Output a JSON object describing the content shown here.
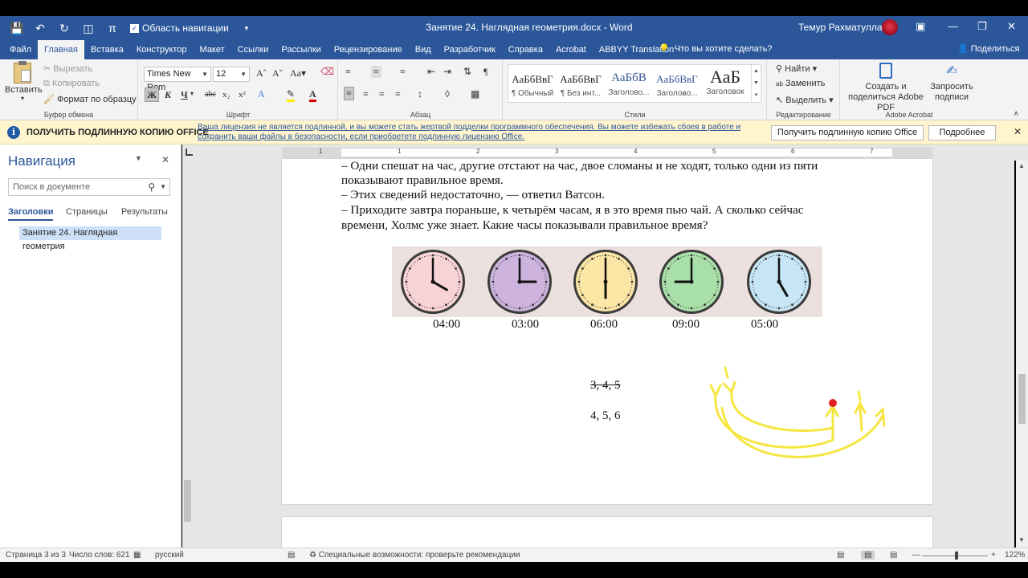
{
  "window": {
    "doc_title": "Занятие 24. Наглядная геометрия.docx  -  Word",
    "user_name": "Темур Рахматуллаев",
    "qat_nav_label": "Область навигации"
  },
  "tabs": [
    "Файл",
    "Главная",
    "Вставка",
    "Конструктор",
    "Макет",
    "Ссылки",
    "Рассылки",
    "Рецензирование",
    "Вид",
    "Разработчик",
    "Справка",
    "Acrobat",
    "ABBYY Translation"
  ],
  "tell_me": "Что вы хотите сделать?",
  "share": "Поделиться",
  "ribbon": {
    "clipboard": {
      "paste": "Вставить",
      "cut": "Вырезать",
      "copy": "Копировать",
      "format_painter": "Формат по образцу",
      "label": "Буфер обмена"
    },
    "font": {
      "name": "Times New Rom",
      "size": "12",
      "label": "Шрифт"
    },
    "paragraph": {
      "label": "Абзац"
    },
    "styles": {
      "label": "Стили",
      "items": [
        {
          "preview": "АаБбВвГ",
          "name": "¶ Обычный"
        },
        {
          "preview": "АаБбВвГ",
          "name": "¶ Без инт..."
        },
        {
          "preview": "АаБбВ",
          "name": "Заголово..."
        },
        {
          "preview": "АаБбВвГ",
          "name": "Заголово..."
        },
        {
          "preview": "АаБ",
          "name": "Заголовок"
        }
      ]
    },
    "editing": {
      "find": "Найти",
      "replace": "Заменить",
      "select": "Выделить",
      "label": "Редактирование"
    },
    "acrobat": {
      "create_share": "Создать и поделиться Adobe PDF",
      "request_sign": "Запросить подписи",
      "label": "Adobe Acrobat"
    }
  },
  "license": {
    "heading": "ПОЛУЧИТЬ ПОДЛИННУЮ КОПИЮ OFFICE",
    "text": "Ваша лицензия не является подлинной, и вы можете стать жертвой подделки программного обеспечения. Вы можете избежать сбоев в работе и сохранить ваши файлы в безопасности, если приобретете подлинную лицензию Office.",
    "get_button": "Получить подлинную копию Office",
    "more_button": "Подробнее"
  },
  "nav": {
    "title": "Навигация",
    "search_placeholder": "Поиск в документе",
    "tabs": [
      "Заголовки",
      "Страницы",
      "Результаты"
    ],
    "heading_item": "Занятие 24. Наглядная геометрия"
  },
  "ruler_numbers": [
    "1",
    "1",
    "2",
    "3",
    "4",
    "5",
    "6",
    "7"
  ],
  "document": {
    "lines": [
      "– Одни спешат на час, другие отстают на час, двое сломаны и не ходят, только одни из пяти",
      "показывают правильное время.",
      "– Этих сведений недостаточно, — ответил Ватсон.",
      "– Приходите завтра пораньше, к четырём часам, я в это время пью чай. А сколько сейчас",
      "времени, Холмс уже знает. Какие часы показывали правильное время?"
    ],
    "clocks": [
      {
        "time": "04:00",
        "hour": 4,
        "face": "#f8d3d6"
      },
      {
        "time": "03:00",
        "hour": 3,
        "face": "#cdb3dd"
      },
      {
        "time": "06:00",
        "hour": 6,
        "face": "#fbe6a6"
      },
      {
        "time": "09:00",
        "hour": 9,
        "face": "#a9e0a9"
      },
      {
        "time": "05:00",
        "hour": 5,
        "face": "#c6e5f5"
      }
    ],
    "answer_struck": "3, 4, 5",
    "answer": "4, 5, 6"
  },
  "status": {
    "page": "Страница 3 из 3",
    "words": "Число слов: 621",
    "language": "русский",
    "accessibility": "Специальные возможности: проверьте рекомендации",
    "zoom": "122%"
  },
  "colors": {
    "accent": "#2b579a",
    "ink": "#f5e642",
    "ink_dot": "#e02020"
  }
}
